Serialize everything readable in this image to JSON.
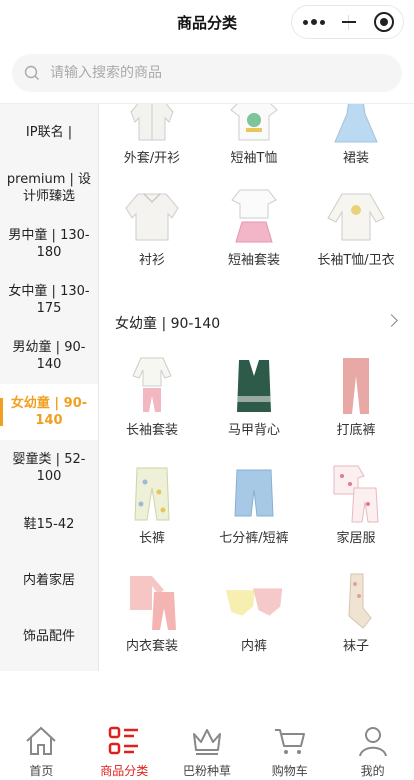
{
  "header": {
    "title": "商品分类"
  },
  "search": {
    "placeholder": "请输入搜索的商品"
  },
  "sidebar": {
    "items": [
      {
        "label": "IP联名 |"
      },
      {
        "label": "premium | 设计师臻选"
      },
      {
        "label": "男中童 | 130-180"
      },
      {
        "label": "女中童 | 130-175"
      },
      {
        "label": "男幼童 | 90-140"
      },
      {
        "label": "女幼童 | 90-140"
      },
      {
        "label": "婴童类 | 52-100"
      },
      {
        "label": "鞋15-42"
      },
      {
        "label": "内着家居"
      },
      {
        "label": "饰品配件"
      }
    ],
    "active_index": 5
  },
  "top_grid": {
    "items": [
      {
        "label": "外套/开衫",
        "icon": "white-jacket"
      },
      {
        "label": "短袖T恤",
        "icon": "white-tshirt"
      },
      {
        "label": "裙装",
        "icon": "blue-dress"
      },
      {
        "label": "衬衫",
        "icon": "white-shirt"
      },
      {
        "label": "短袖套装",
        "icon": "shirt-skirt-set"
      },
      {
        "label": "长袖T恤/卫衣",
        "icon": "white-sweatshirt"
      }
    ]
  },
  "section": {
    "title": "女幼童 | 90-140"
  },
  "section_grid": {
    "items": [
      {
        "label": "长袖套装",
        "icon": "long-sleeve-set"
      },
      {
        "label": "马甲背心",
        "icon": "green-vest"
      },
      {
        "label": "打底裤",
        "icon": "pink-leggings"
      },
      {
        "label": "长裤",
        "icon": "floral-pants"
      },
      {
        "label": "七分裤/短裤",
        "icon": "denim-shorts"
      },
      {
        "label": "家居服",
        "icon": "pajama-set"
      },
      {
        "label": "内衣套装",
        "icon": "pink-underwear-set"
      },
      {
        "label": "内裤",
        "icon": "yellow-briefs"
      },
      {
        "label": "袜子",
        "icon": "beige-socks"
      }
    ]
  },
  "tabbar": {
    "items": [
      {
        "label": "首页",
        "icon": "home-icon"
      },
      {
        "label": "商品分类",
        "icon": "category-icon"
      },
      {
        "label": "巴粉种草",
        "icon": "crown-icon"
      },
      {
        "label": "购物车",
        "icon": "cart-icon"
      },
      {
        "label": "我的",
        "icon": "user-icon"
      }
    ],
    "active_index": 1
  },
  "colors": {
    "accent": "#f0a020",
    "tab_active": "#e0201a",
    "sidebar_bg": "#f6f6f6"
  }
}
